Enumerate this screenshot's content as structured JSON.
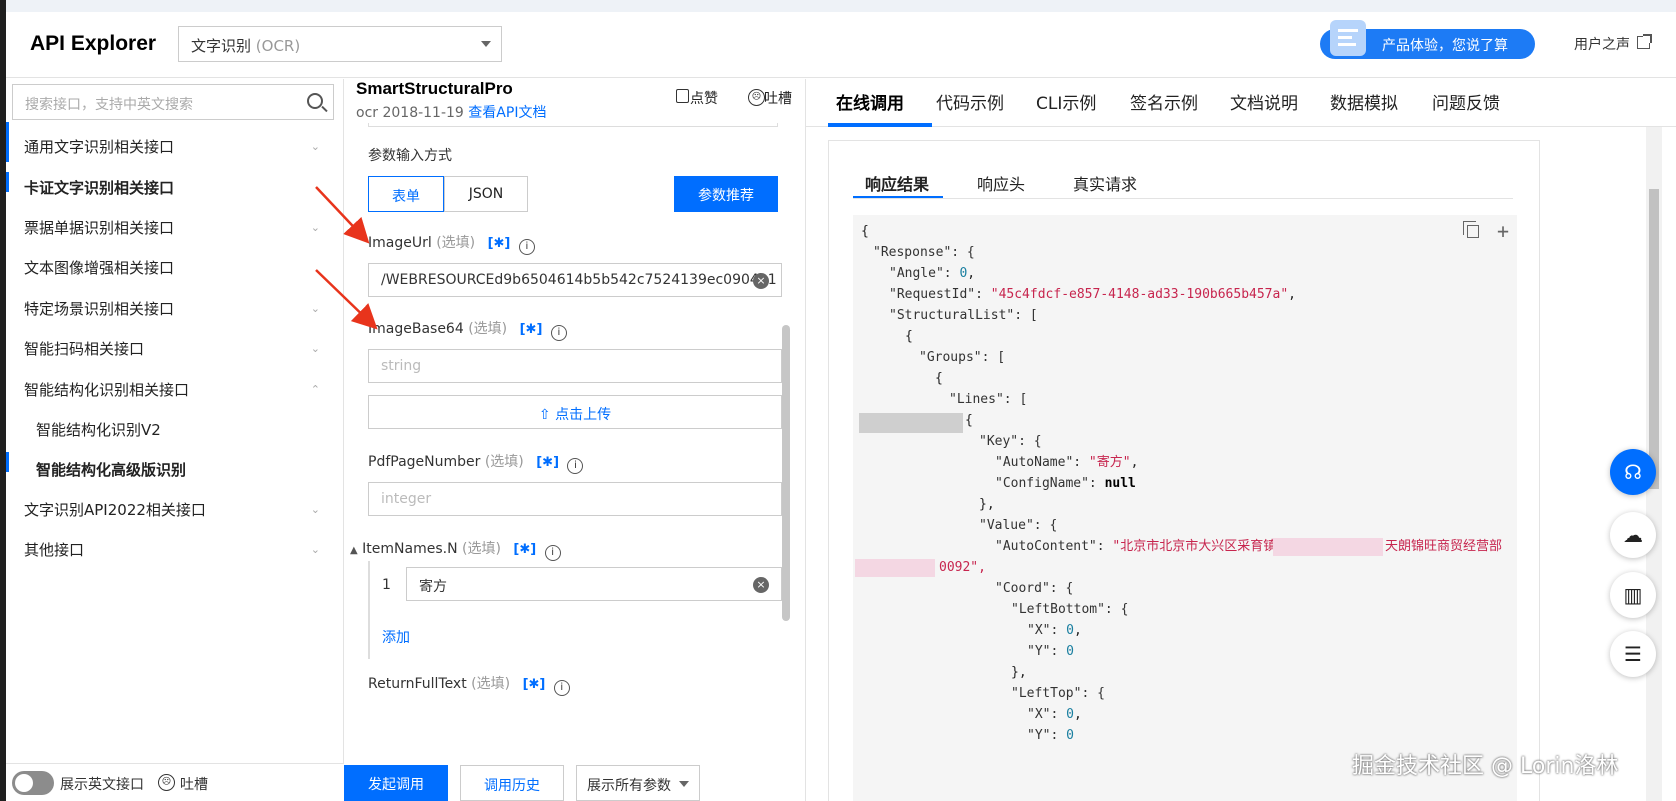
{
  "header": {
    "logo": "API Explorer",
    "product_main": "文字识别",
    "product_sub": "(OCR)",
    "feedback_pill": "产品体验，您说了算",
    "user_voice": "用户之声"
  },
  "sidebar": {
    "search_placeholder": "搜索接口，支持中英文搜索",
    "items": [
      {
        "label": "通用文字识别相关接口",
        "chev": "⌄"
      },
      {
        "label": "卡证文字识别相关接口",
        "chev": ""
      },
      {
        "label": "票据单据识别相关接口",
        "chev": "⌄"
      },
      {
        "label": "文本图像增强相关接口",
        "chev": ""
      },
      {
        "label": "特定场景识别相关接口",
        "chev": "⌄"
      },
      {
        "label": "智能扫码相关接口",
        "chev": "⌄"
      },
      {
        "label": "智能结构化识别相关接口",
        "chev": "⌃"
      },
      {
        "label": "智能结构化识别V2",
        "chev": ""
      },
      {
        "label": "智能结构化高级版识别",
        "chev": ""
      },
      {
        "label": "文字识别API2022相关接口",
        "chev": "⌄"
      },
      {
        "label": "其他接口",
        "chev": "⌄"
      }
    ],
    "footer_toggle_label": "展示英文接口",
    "footer_feedback": "吐槽"
  },
  "middle": {
    "api_name": "SmartStructuralPro",
    "api_version": "ocr 2018-11-19",
    "doc_link": "查看API文档",
    "like": "点赞",
    "complain": "吐槽",
    "input_mode_label": "参数输入方式",
    "mode_form": "表单",
    "mode_json": "JSON",
    "recommend_button": "参数推荐",
    "optional": "(选填)",
    "bracket": "[✱]",
    "info": "i",
    "params": {
      "image_url": "ImageUrl",
      "image_url_value": "/WEBRESOURCEd9b6504614b5b542c7524139ec0904b1",
      "image_base64": "ImageBase64",
      "image_base64_placeholder": "string",
      "upload": "点击上传",
      "pdf_page": "PdfPageNumber",
      "pdf_placeholder": "integer",
      "item_names": "ItemNames.N",
      "item_index": "1",
      "item_value": "寄方",
      "add": "添加",
      "return_full_text": "ReturnFullText"
    },
    "footer": {
      "call": "发起调用",
      "history": "调用历史",
      "show_params": "展示所有参数"
    }
  },
  "right": {
    "tabs": [
      "在线调用",
      "代码示例",
      "CLI示例",
      "签名示例",
      "文档说明",
      "数据模拟",
      "问题反馈"
    ],
    "subtabs": [
      "响应结果",
      "响应头",
      "真实请求"
    ],
    "code": {
      "open": "{",
      "response_key": "\"Response\": {",
      "angle_key": "\"Angle\": ",
      "angle_val": "0",
      "reqid_key": "\"RequestId\": ",
      "reqid_val": "\"45c4fdcf-e857-4148-ad33-190b665b457a\"",
      "struct_key": "\"StructuralList\": [",
      "brace_open": "{",
      "groups_key": "\"Groups\": [",
      "lines_key": "\"Lines\": [",
      "key_key": "\"Key\": {",
      "autoname_key": "\"AutoName\": ",
      "autoname_val": "\"寄方\"",
      "configname_key": "\"ConfigName\": ",
      "configname_val": "null",
      "close_comma": "},",
      "value_key": "\"Value\": {",
      "autocontent_key": "\"AutoContent\": ",
      "autocontent_val": "\"北京市北京市大兴区采育镇采伟路",
      "autocontent_tail": "天朗锦旺商贸经营部",
      "autocontent_wrap": "0092\",",
      "coord_key": "\"Coord\": {",
      "leftbottom_key": "\"LeftBottom\": {",
      "x_key": "\"X\": ",
      "x_val": "0",
      "y_key": "\"Y\": ",
      "y_val": "0",
      "lefttop_key": "\"LeftTop\": {"
    }
  },
  "watermark": "掘金技术社区 @ Lorin洛林",
  "colors": {
    "accent": "#006eff",
    "string": "#c7254e",
    "number": "#1a7fa0",
    "arrow": "#e8341c"
  }
}
